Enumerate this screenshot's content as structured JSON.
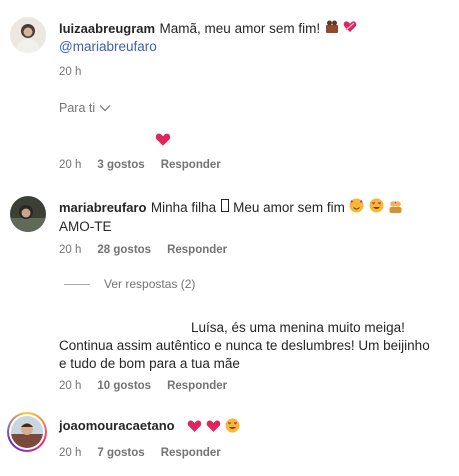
{
  "comments": [
    {
      "username": "luizaabreugram",
      "text": "Mamã, meu amor sem fim!",
      "mention": "@mariabreufaro",
      "time": "20 h"
    },
    {
      "username": "",
      "text": "",
      "time": "20 h",
      "likes": "3 gostos",
      "reply": "Responder"
    },
    {
      "username": "mariabreufaro",
      "text": "Minha filha",
      "text2": "Meu amor sem fim",
      "text_line2": "AMO-TE",
      "time": "20 h",
      "likes": "28 gostos",
      "reply": "Responder"
    },
    {
      "text_line1": "Luísa, és uma menina muito meiga!",
      "text_line2": "Continua assim autêntico e nunca te deslumbres! Um beijinho",
      "text_line3": "e tudo de bom para a tua mãe",
      "time": "20 h",
      "likes": "10 gostos",
      "reply": "Responder"
    },
    {
      "username": "joaomouracaetano",
      "time": "20 h",
      "likes": "7 gostos",
      "reply": "Responder"
    }
  ],
  "for_you": {
    "label": "Para ti"
  },
  "view_replies": "Ver respostas (2)",
  "colors": {
    "heart": "#e0245e",
    "link": "#3e5fb4",
    "meta": "#737373"
  }
}
